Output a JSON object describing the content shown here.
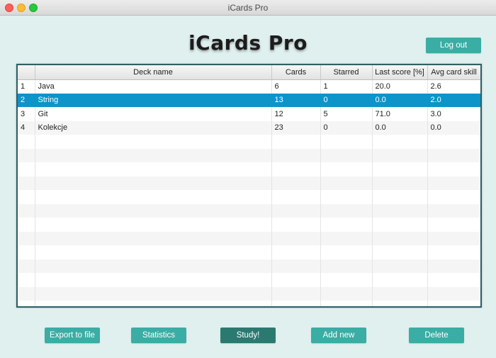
{
  "window": {
    "title": "iCards Pro"
  },
  "header": {
    "title": "iCards Pro",
    "logout_label": "Log out"
  },
  "table": {
    "columns": [
      "",
      "Deck name",
      "Cards",
      "Starred",
      "Last score [%]",
      "Avg card skill"
    ],
    "rows": [
      [
        "1",
        "Java",
        "6",
        "1",
        "20.0",
        "2.6"
      ],
      [
        "2",
        "String",
        "13",
        "0",
        "0.0",
        "2.0"
      ],
      [
        "3",
        "Git",
        "12",
        "5",
        "71.0",
        "3.0"
      ],
      [
        "4",
        "Kolekcje",
        "23",
        "0",
        "0.0",
        "0.0"
      ]
    ],
    "selected_row": 1
  },
  "actions": {
    "export_label": "Export to file",
    "statistics_label": "Statistics",
    "study_label": "Study!",
    "add_new_label": "Add new",
    "delete_label": "Delete"
  },
  "colors": {
    "accent": "#3aada4",
    "accent_dark": "#2a7a70",
    "selection": "#0d94c9",
    "background": "#dff0ef"
  }
}
